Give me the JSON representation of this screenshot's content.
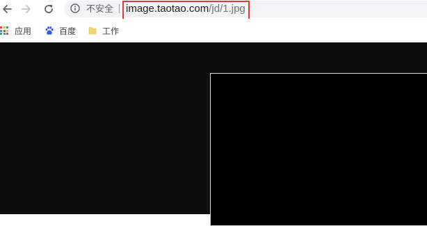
{
  "browser": {
    "security_label": "不安全",
    "url": {
      "host": "image.taotao.com",
      "path": "/jd/1.jpg"
    },
    "icons": {
      "back": "arrow-left-icon",
      "forward": "arrow-right-icon",
      "reload": "reload-icon",
      "info": "info-icon"
    },
    "highlight_color": "#e53935"
  },
  "bookmarks": [
    {
      "label": "应用",
      "icon": "apps-grid-icon"
    },
    {
      "label": "百度",
      "icon": "baidu-paw-icon"
    },
    {
      "label": "工作",
      "icon": "folder-icon"
    }
  ],
  "colors": {
    "page_background": "#0e0e0e",
    "image_background": "#000000"
  }
}
